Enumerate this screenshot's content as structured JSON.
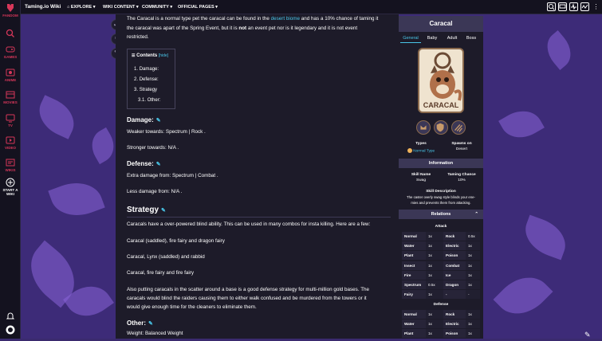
{
  "colors": {
    "brand": "#d7375a",
    "accent": "#49c6e8",
    "page": "#1d1b29",
    "background": "#3d2b78",
    "header": "#3b3756"
  },
  "rail": {
    "fandom": "FANDOM",
    "items": [
      {
        "label": "GAMES",
        "icon": "gamepad-icon"
      },
      {
        "label": "ANIME",
        "icon": "anime-icon"
      },
      {
        "label": "MOVIES",
        "icon": "movie-icon"
      },
      {
        "label": "TV",
        "icon": "tv-icon"
      },
      {
        "label": "VIDEO",
        "icon": "video-icon"
      },
      {
        "label": "WIKIS",
        "icon": "wikis-icon"
      }
    ],
    "start_line1": "START A",
    "start_line2": "WIKI"
  },
  "topbar": {
    "wiki_name": "Taming.io Wiki",
    "nav": [
      "EXPLORE",
      "WIKI CONTENT",
      "COMMUNITY",
      "OFFICIAL PAGES"
    ]
  },
  "article": {
    "intro": {
      "p1_a": "The Caracal is a normal type pet the caracal can be found in the ",
      "p1_link": "desert biome",
      "p1_b": " and has a 10% chance of taming it",
      "p2_a": "the caracal was apart of the Spring Event, but it is ",
      "p2_bold": "not",
      "p2_b": " an event pet nor is it legendary and it is not event",
      "p3": "restricted."
    },
    "toc": {
      "title": "Contents",
      "hide": "[hide]",
      "items": [
        {
          "num": "1.",
          "text": "Damage:"
        },
        {
          "num": "2.",
          "text": "Defense:"
        },
        {
          "num": "3.",
          "text": "Strategy"
        },
        {
          "num": "3.1.",
          "text": "Other:"
        }
      ]
    },
    "damage": {
      "heading": "Damage:",
      "weak": "Weaker towards: Spectrum | Rock .",
      "strong": "Stronger towards: N/A ."
    },
    "defense": {
      "heading": "Defense:",
      "extra": "Extra damage from: Spectrum | Combat .",
      "less": "Less damage from: N/A ."
    },
    "strategy": {
      "heading": "Strategy",
      "p1": "Caracals have a over-powered blind ability. This can be used in many combos for insta killing. Here are a few:",
      "combo1": "Caracal (saddled), fire fairy and dragon fairy",
      "combo2": "Caracal, Lynx (saddled) and rabbid",
      "combo3": "Caracal, fire fairy and fire fairy",
      "p2_1": "Also putting caracals in the scatter around a base is a good defense strategy for multi-million gold bases. The",
      "p2_2": "caracals would blind the raiders causing them to either walk confused and be murdered from the towers or it",
      "p2_3": "would give enough time for the cleaners to eliminate them."
    },
    "other": {
      "heading": "Other:",
      "weight": "Weight: Balanced Weight"
    }
  },
  "infobox": {
    "title": "Caracal",
    "tabs": [
      "General",
      "Baby",
      "Adult",
      "Boss"
    ],
    "card_label": "CARACAL",
    "types_label": "Types",
    "types_value": "Normal Type",
    "spawns_label": "Spawns on",
    "spawns_value": "Desert",
    "information": "Information",
    "skill_name_label": "Skill Name",
    "skill_name_value": "Swag",
    "taming_label": "Taming Chance",
    "taming_value": "10%",
    "skill_desc_label": "Skill Description",
    "skill_desc_1": "The caster overly swag style blinds your ene-",
    "skill_desc_2": "mies and prevents them from attacking.",
    "relations": "Relations",
    "attack": "Attack",
    "attack_rows": [
      [
        "Normal",
        "1x",
        "Rock",
        "0.5x"
      ],
      [
        "Water",
        "1x",
        "Electric",
        "1x"
      ],
      [
        "Plant",
        "1x",
        "Poison",
        "1x"
      ],
      [
        "Insect",
        "1x",
        "Combat",
        "1x"
      ],
      [
        "Fire",
        "1x",
        "Ice",
        "1x"
      ],
      [
        "Spectrum",
        "0.5x",
        "Dragon",
        "1x"
      ],
      [
        "Fairy",
        "1x",
        "-",
        "-"
      ]
    ],
    "defense": "Defense",
    "defense_rows": [
      [
        "Normal",
        "1x",
        "Rock",
        "1x"
      ],
      [
        "Water",
        "1x",
        "Electric",
        "1x"
      ],
      [
        "Plant",
        "1x",
        "Poison",
        "1x"
      ]
    ]
  }
}
